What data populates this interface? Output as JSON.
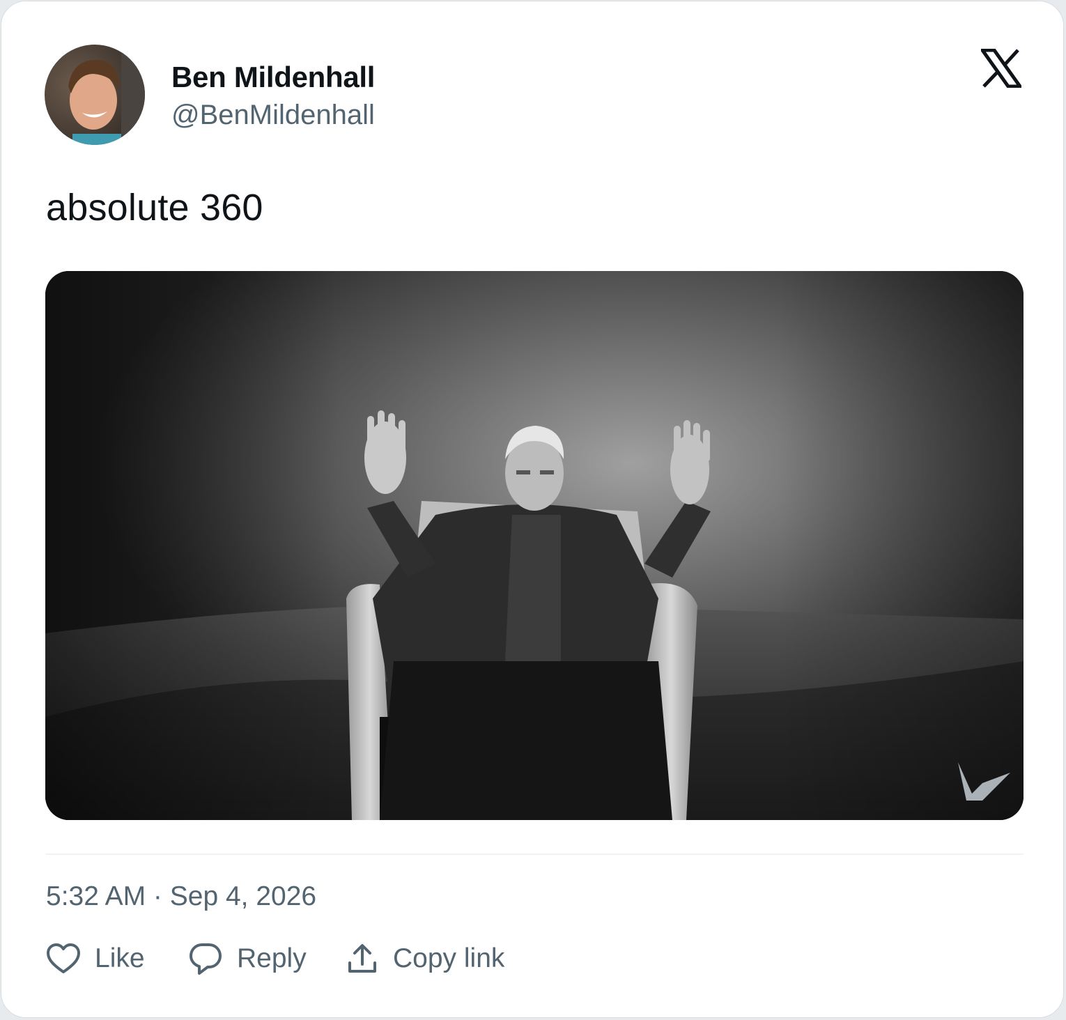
{
  "tweet": {
    "author": {
      "display_name": "Ben Mildenhall",
      "handle": "@BenMildenhall",
      "avatar_icon": "profile-photo"
    },
    "platform_icon": "x-logo-icon",
    "text": "absolute 360",
    "media": {
      "type": "image",
      "description_icon": "video-still"
    },
    "timestamp": "5:32 AM · Sep 4, 2026",
    "actions": {
      "like_label": "Like",
      "reply_label": "Reply",
      "copy_link_label": "Copy link"
    }
  },
  "colors": {
    "text_primary": "#0f1419",
    "text_secondary": "#536471",
    "divider": "#eff3f4",
    "card_border": "#d8dde2"
  }
}
